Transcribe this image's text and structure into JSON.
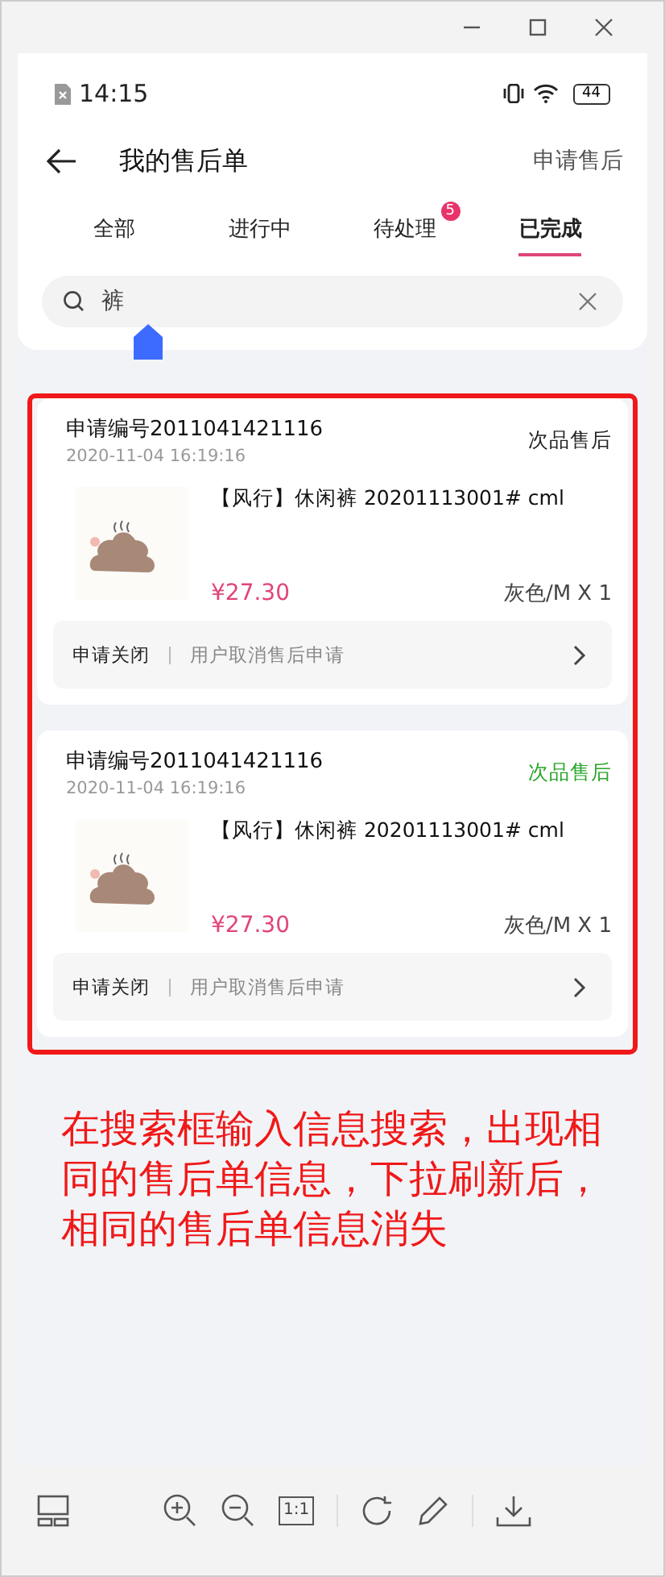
{
  "status_bar": {
    "time": "14:15",
    "battery": "44"
  },
  "header": {
    "title": "我的售后单",
    "action": "申请售后"
  },
  "tabs": [
    {
      "label": "全部",
      "selected": false
    },
    {
      "label": "进行中",
      "selected": false
    },
    {
      "label": "待处理",
      "selected": false,
      "badge": "5"
    },
    {
      "label": "已完成",
      "selected": true
    }
  ],
  "search": {
    "value": "裤"
  },
  "orders": [
    {
      "number": "申请编号2011041421116",
      "time": "2020-11-04 16:19:16",
      "type": "次品售后",
      "color": "#222222",
      "product": "【风行】休闲裤  20201113001#  cml",
      "price": "¥27.30",
      "spec": "灰色/M X 1",
      "status": "申请关闭",
      "note": "用户取消售后申请"
    },
    {
      "number": "申请编号2011041421116",
      "time": "2020-11-04 16:19:16",
      "type": "次品售后",
      "color": "#2aa52a",
      "product": "【风行】休闲裤  20201113001#  cml",
      "price": "¥27.30",
      "spec": "灰色/M X 1",
      "status": "申请关闭",
      "note": "用户取消售后申请"
    }
  ],
  "annotation": "在搜索框输入信息搜索，出现相同的售后单信息，下拉刷新后，相同的售后单信息消失",
  "toolbar": {
    "actual_size": "1:1"
  }
}
